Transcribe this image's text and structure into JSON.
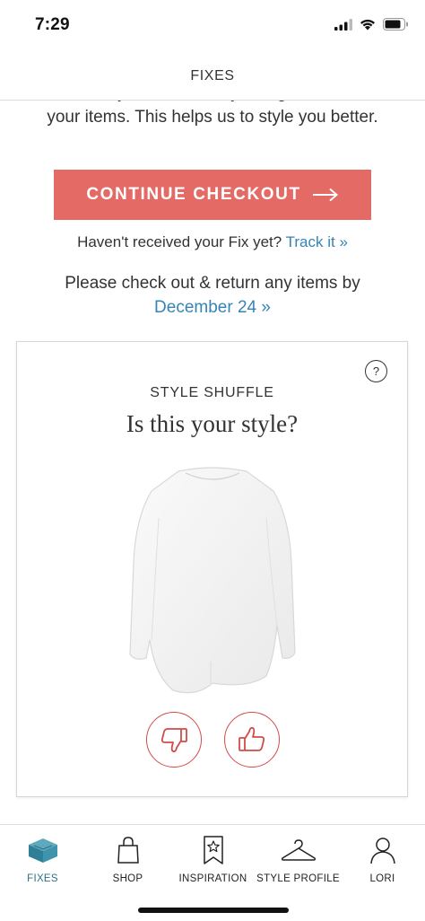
{
  "status_bar": {
    "time": "7:29",
    "icons": [
      "cellular-signal-icon",
      "wifi-icon",
      "battery-icon"
    ]
  },
  "header": {
    "title": "FIXES"
  },
  "main": {
    "intro_text": "Decide what you'd like to buy and give feedback on your items. This helps us to style you better.",
    "checkout_button_label": "CONTINUE CHECKOUT",
    "checkout_button_icon": "arrow-right-icon",
    "track_prefix": "Haven't received your Fix yet?",
    "track_link": "Track it »",
    "return_text": "Please check out & return any items by",
    "return_date_link": "December 24 »"
  },
  "style_shuffle": {
    "eyebrow": "STYLE SHUFFLE",
    "question": "Is this your style?",
    "help_label": "?",
    "image": "white-dolman-sweater",
    "vote_icons": [
      "thumbs-down-icon",
      "thumbs-up-icon"
    ]
  },
  "tab_bar": {
    "tabs": [
      {
        "label": "FIXES",
        "icon": "box-icon",
        "active": true
      },
      {
        "label": "SHOP",
        "icon": "shopping-bag-icon",
        "active": false
      },
      {
        "label": "INSPIRATION",
        "icon": "bookmark-star-icon",
        "active": false
      },
      {
        "label": "STYLE PROFILE",
        "icon": "hanger-icon",
        "active": false
      },
      {
        "label": "LORI",
        "icon": "person-icon",
        "active": false
      }
    ]
  },
  "colors": {
    "accent": "#e46a66",
    "link": "#3584b7",
    "vote_red": "#d24b48",
    "active_tab": "#2d6f86"
  }
}
